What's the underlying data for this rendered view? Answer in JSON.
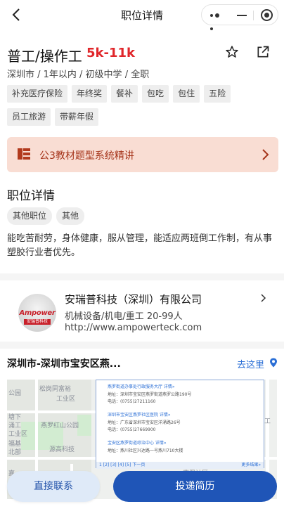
{
  "header": {
    "title": "职位详情"
  },
  "job": {
    "title": "普工/操作工",
    "salary": "5k-11k",
    "meta": "深圳市 / 1年以内 / 初级中学 / 全职",
    "benefits": [
      "补充医疗保险",
      "年终奖",
      "餐补",
      "包吃",
      "包住",
      "五险",
      "员工旅游",
      "带薪年假"
    ]
  },
  "banner": {
    "text": "公3教材题型系统精讲"
  },
  "details": {
    "section_title": "职位详情",
    "categories": [
      "其他职位",
      "其他"
    ],
    "description": "能吃苦耐劳，身体健康，服从管理，能适应两班倒工作制，有从事塑胶行业者优先。"
  },
  "company": {
    "logo_text": "Ampower",
    "logo_subtext": "安瑞普科技",
    "name": "安瑞普科技（深圳）有限公司",
    "industry": "机械设备/机电/重工 20-99人",
    "url": "http://www.ampowerteck.com"
  },
  "location": {
    "address": "深圳市-深圳市宝安区燕...",
    "goto_label": "去这里",
    "map": {
      "labels": [
        "公园",
        "松岗同富裕",
        "工业区",
        "燕罗红山公园",
        "塘下",
        "涌工",
        "工业区",
        "福基",
        "源高科技",
        "北部",
        "嘉",
        "燕罗社区",
        "大宏工"
      ],
      "popup_entries": [
        {
          "name": "燕罗街道办事处行政服务大厅  详情»",
          "addr": "地址：深圳市宝安区燕罗街道燕罗公路190号",
          "tel": "电话：(0755)27211160"
        },
        {
          "name": "深圳市宝安区燕罗社区医院  详情»",
          "addr": "地址：广东省深圳市宝安区洋涌路26号",
          "tel": "电话：(0755)27669900"
        },
        {
          "name": "宝安区燕罗街道综治中心  详情»",
          "addr": "地址：燕川社区兴达路一号燕川710大楼",
          "tel": ""
        }
      ],
      "pager": "1 [2] [3] [4] [5] 下一页",
      "pager_more": "更多结果»"
    }
  },
  "actions": {
    "contact_label": "直接联系",
    "apply_label": "投递简历"
  },
  "colors": {
    "salary": "#e0262a",
    "primary": "#1f55b7",
    "banner_bg": "#f9ddd3",
    "banner_text": "#a5341a",
    "link": "#2b6fd6"
  }
}
